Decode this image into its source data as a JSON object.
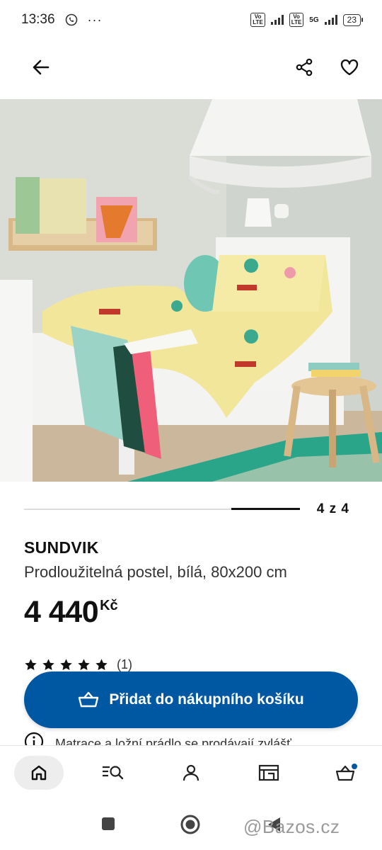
{
  "status_bar": {
    "time": "13:36",
    "network_1": "VoLTE",
    "network_2": "5G",
    "battery": "23"
  },
  "product": {
    "name": "SUNDVIK",
    "description": "Prodloužitelná postel, bílá, 80x200 cm",
    "price": "4 440",
    "currency": "Kč",
    "rating_count": "(1)",
    "rating_stars": 5,
    "notice": "Matrace a ložní prádlo se prodávají zvlášť"
  },
  "carousel": {
    "counter": "4 z 4",
    "current": 4,
    "total": 4
  },
  "actions": {
    "add_to_cart": "Přidat do nákupního košíku"
  },
  "icons": {
    "back": "arrow-left-icon",
    "share": "share-icon",
    "favorite": "heart-icon",
    "cart": "basket-icon",
    "home": "home-icon",
    "search": "search-list-icon",
    "profile": "person-icon",
    "store": "store-icon",
    "basket_nav": "basket-icon"
  },
  "watermark": "@Bazos.cz",
  "colors": {
    "accent": "#0058a3",
    "cart_badge": "#0058a3"
  }
}
